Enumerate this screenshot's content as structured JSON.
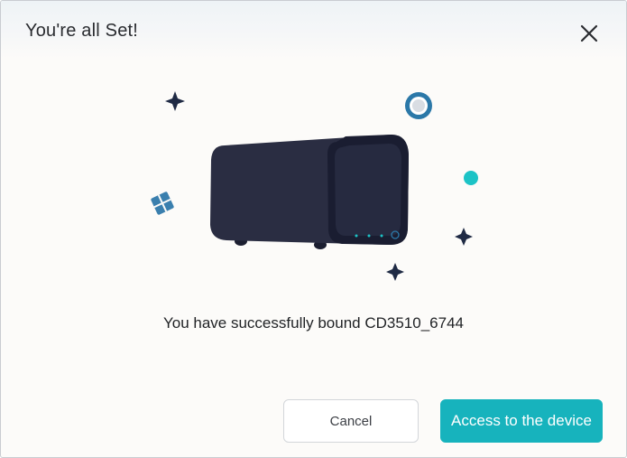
{
  "dialog": {
    "title": "You're all Set!",
    "close_icon": "close-icon",
    "message": "You have successfully bound CD3510_6744",
    "illustration": {
      "device": "camera-device-illustration",
      "decorations": [
        "sparkle-icon",
        "ring-icon",
        "dot-icon",
        "diamond-tile-icon"
      ]
    }
  },
  "buttons": {
    "cancel_label": "Cancel",
    "primary_label": "Access to the device"
  },
  "colors": {
    "accent": "#17b3bd",
    "device_body": "#2a2d42",
    "device_face": "#1c1f33",
    "sparkle": "#1f2a44",
    "ring": "#2b78a8",
    "dot": "#1cc3c6",
    "tile": "#3a7fae",
    "background": "#fcfbf9"
  }
}
